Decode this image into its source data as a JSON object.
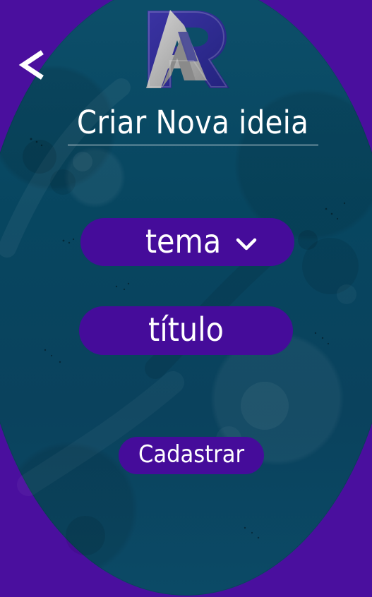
{
  "screen": {
    "title": "Criar Nova ideia"
  },
  "form": {
    "theme_select": {
      "selected_value": "tema"
    },
    "title_field": {
      "value": "título"
    },
    "submit_label": "Cadastrar"
  },
  "icons": {
    "back": "back-arrow-icon",
    "logo": "r-logo",
    "dropdown": "chevron-down-icon"
  },
  "colors": {
    "frame_background": "#4a0f9e",
    "surface_background": "#074660",
    "accent_purple": "#450c9a",
    "text_primary": "#ffffff",
    "logo_gray": "#a3a3a3",
    "logo_blue": "#2f2f94"
  }
}
